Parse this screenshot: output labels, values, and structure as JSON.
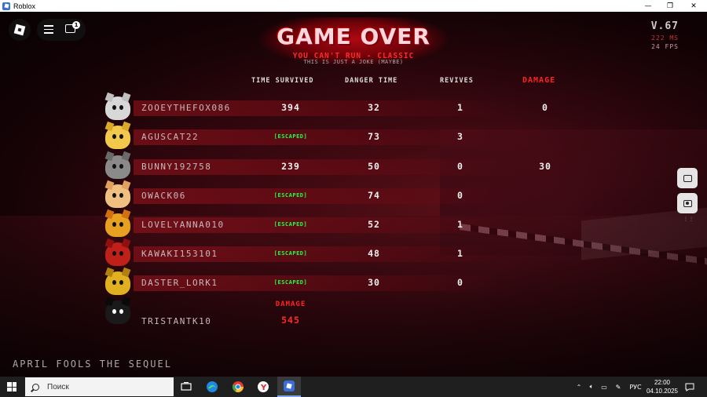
{
  "window": {
    "title": "Roblox",
    "controls": {
      "minimize": "—",
      "maximize": "❐",
      "close": "✕"
    }
  },
  "roblox_ui": {
    "chat_badge": "1"
  },
  "stats": {
    "version": "V.67",
    "ping": "222 MS",
    "fps": "24 FPS"
  },
  "header": {
    "title": "GAME OVER",
    "subtitle": "YOU CAN'T RUN - CLASSIC",
    "joke": "THIS IS JUST A JOKE (MAYBE)"
  },
  "columns": {
    "time_survived": "TIME SURVIVED",
    "danger_time": "DANGER TIME",
    "revives": "REVIVES",
    "damage": "DAMAGE"
  },
  "players": [
    {
      "name": "ZOOEYTHEFOX086",
      "time": "394",
      "escaped": false,
      "danger": "32",
      "revives": "1",
      "damage": "0",
      "color": "#d8d8d8",
      "ear": "#c0c0c0"
    },
    {
      "name": "AGUSCAT22",
      "time": "[ESCAPED]",
      "escaped": true,
      "danger": "73",
      "revives": "3",
      "damage": "",
      "color": "#f2c94c",
      "ear": "#d9a92a"
    },
    {
      "name": "BUNNY192758",
      "time": "239",
      "escaped": false,
      "danger": "50",
      "revives": "0",
      "damage": "30",
      "color": "#8a8a8a",
      "ear": "#6a6a6a"
    },
    {
      "name": "OWACK06",
      "time": "[ESCAPED]",
      "escaped": true,
      "danger": "74",
      "revives": "0",
      "damage": "",
      "color": "#f0c080",
      "ear": "#e0a060"
    },
    {
      "name": "LOVELYANNA010",
      "time": "[ESCAPED]",
      "escaped": true,
      "danger": "52",
      "revives": "1",
      "damage": "",
      "color": "#e8a020",
      "ear": "#d07010"
    },
    {
      "name": "KAWAKI153101",
      "time": "[ESCAPED]",
      "escaped": true,
      "danger": "48",
      "revives": "1",
      "damage": "",
      "color": "#c0201a",
      "ear": "#901010"
    },
    {
      "name": "DASTER_LORK1",
      "time": "[ESCAPED]",
      "escaped": true,
      "danger": "30",
      "revives": "0",
      "damage": "",
      "color": "#e0b020",
      "ear": "#b08010"
    }
  ],
  "killer": {
    "name": "TRISTANTK10",
    "damage_label": "DAMAGE",
    "damage": "545",
    "color": "#1a1a1a",
    "ear": "#0a0a0a"
  },
  "footer": {
    "game_name": "APRIL FOOLS THE SEQUEL"
  },
  "taskbar": {
    "search_placeholder": "Поиск",
    "language": "РУС",
    "time": "22:00",
    "date": "04.10.2025"
  }
}
